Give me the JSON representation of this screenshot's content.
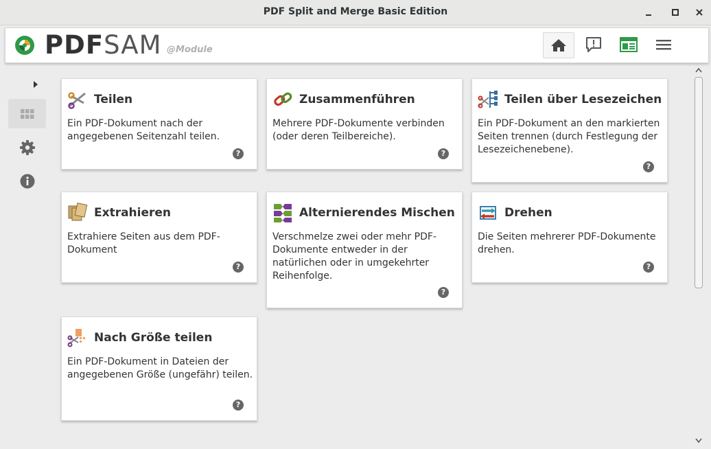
{
  "window": {
    "title": "PDF Split and Merge Basic Edition",
    "controls": [
      "minimize",
      "maximize",
      "close"
    ]
  },
  "header": {
    "logo_pdf": "PDF",
    "logo_sam": "SAM",
    "logo_module": "@Module",
    "buttons": [
      "home-icon",
      "feedback-icon",
      "news-icon",
      "menu-icon"
    ],
    "accent_color": "#2e9a48"
  },
  "sidebar": {
    "items": [
      "expand-arrow-icon",
      "modules-grid-icon",
      "settings-gear-icon",
      "info-icon"
    ]
  },
  "modules": [
    {
      "title": "Teilen",
      "description": "Ein PDF-Dokument nach der angegebenen Seitenzahl teilen.",
      "icon": "scissors-icon"
    },
    {
      "title": "Zusammenführen",
      "description": "Mehrere PDF-Dokumente verbinden (oder deren Teilbereiche).",
      "icon": "chain-link-icon"
    },
    {
      "title": "Teilen über Lesezeichen",
      "description": "Ein PDF-Dokument an den markierten Seiten trennen (durch Festlegung der Lesezeichenebene).",
      "icon": "bookmark-tree-scissors-icon"
    },
    {
      "title": "Extrahieren",
      "description": "Extrahiere Seiten aus dem PDF-Dokument",
      "icon": "extract-pages-icon"
    },
    {
      "title": "Alternierendes Mischen",
      "description": "Verschmelze zwei oder mehr PDF-Dokumente entweder in der natürlichen oder in umgekehrter Reihenfolge.",
      "icon": "alternate-mix-icon"
    },
    {
      "title": "Drehen",
      "description": "Die Seiten mehrerer PDF-Dokumente drehen.",
      "icon": "rotate-icon"
    },
    {
      "title": "Nach Größe teilen",
      "description": "Ein PDF-Dokument in Dateien der angegebenen Größe (ungefähr) teilen.",
      "icon": "split-by-size-icon"
    }
  ],
  "help_glyph": "?"
}
